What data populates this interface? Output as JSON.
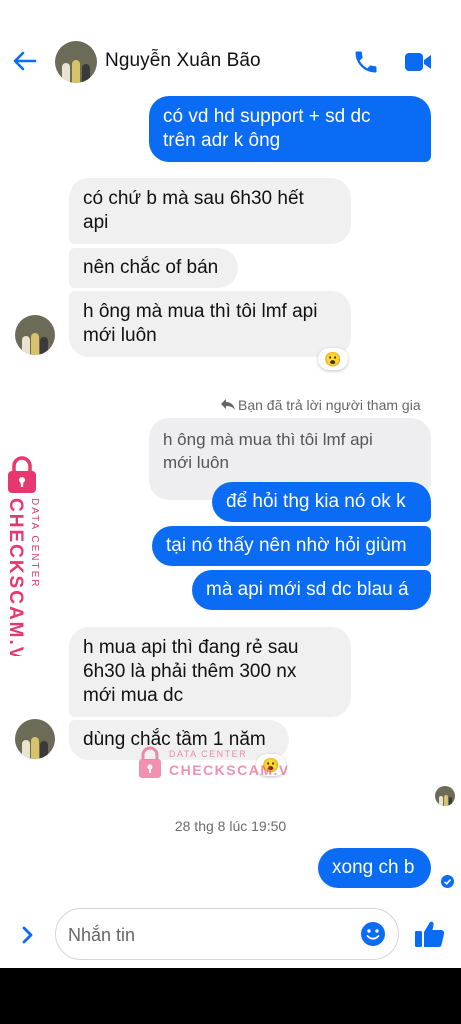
{
  "header": {
    "contact_name": "Nguyễn Xuân Bão"
  },
  "messages": {
    "m1": {
      "l1": "có vd hd support + sd dc",
      "l2": "trên adr k ông"
    },
    "m2": {
      "l1": "có chứ b mà sau 6h30 hết",
      "l2": "api"
    },
    "m3": {
      "l1": "nên chắc of bán"
    },
    "m4": {
      "l1": "h ông mà mua thì tôi lmf api",
      "l2": "mới luôn",
      "reaction": "😮"
    },
    "reply_note": "Bạn đã trả lời người tham gia",
    "quoted": {
      "l1": "h ông mà mua thì tôi lmf api",
      "l2": "mới luôn"
    },
    "m5": {
      "l1": "để hỏi thg kia nó ok k"
    },
    "m6": {
      "l1": "tại nó thấy nên nhờ hỏi giùm"
    },
    "m7": {
      "l1": "mà api mới sd dc blau á"
    },
    "m8": {
      "l1": "h mua api thì đang rẻ sau",
      "l2": "6h30 là phải thêm 300 nx",
      "l3": "mới mua dc"
    },
    "m9": {
      "l1": "dùng chắc tầm 1 năm",
      "reaction": "😮"
    },
    "timestamp": "28 thg 8 lúc 19:50",
    "m10": {
      "l1": "xong ch b"
    }
  },
  "composer": {
    "placeholder": "Nhắn tin"
  },
  "watermark": {
    "side_brand": "CHECKSCAM.VN",
    "side_sub": "DATA CENTER",
    "center_brand": "CHECKSCAM.VN",
    "center_sub": "DATA CENTER"
  },
  "colors": {
    "accent": "#0a6cf5",
    "incoming_bubble": "#f0f0f0",
    "watermark": "#e8366e"
  }
}
